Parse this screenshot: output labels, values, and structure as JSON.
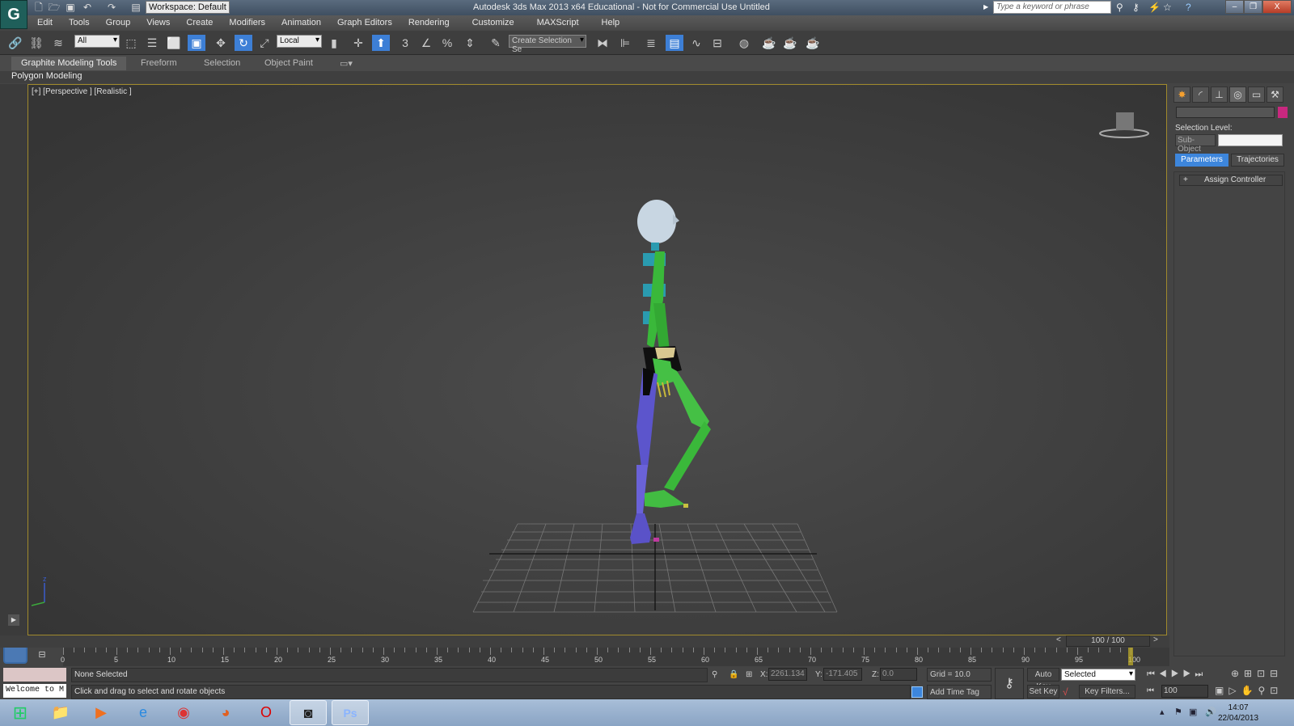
{
  "titlebar": {
    "workspace": "Workspace: Default",
    "title": "Autodesk 3ds Max  2013 x64   Educational - Not for Commercial Use    Untitled",
    "search_placeholder": "Type a keyword or phrase"
  },
  "menu": [
    "Edit",
    "Tools",
    "Group",
    "Views",
    "Create",
    "Modifiers",
    "Animation",
    "Graph Editors",
    "Rendering",
    "Customize",
    "MAXScript",
    "Help"
  ],
  "toolbar": {
    "selection_filter": "All",
    "ref_coord": "Local",
    "selection_set": "Create Selection Se",
    "snap_angle": "3",
    "snap_percent": "%"
  },
  "ribbon": {
    "tabs": [
      "Graphite Modeling Tools",
      "Freeform",
      "Selection",
      "Object Paint"
    ],
    "sub": "Polygon Modeling"
  },
  "viewport": {
    "label": "[+] [Perspective ] [Realistic ]",
    "axis_z": "z"
  },
  "command_panel": {
    "selection_level": "Selection Level:",
    "sub_object": "Sub-Object",
    "parameters": "Parameters",
    "trajectories": "Trajectories",
    "assign_controller": "Assign Controller",
    "color": "#c8287f"
  },
  "timeline": {
    "slider": "100 / 100",
    "ticks": [
      "0",
      "5",
      "10",
      "15",
      "20",
      "25",
      "30",
      "35",
      "40",
      "45",
      "50",
      "55",
      "60",
      "65",
      "70",
      "75",
      "80",
      "85",
      "90",
      "95",
      "100"
    ],
    "current_frame": 100,
    "total_frames": 100
  },
  "status": {
    "selection": "None Selected",
    "prompt": "Click and drag to select and rotate objects",
    "listener": "Welcome to M",
    "x_label": "X:",
    "x": "2261.134",
    "y_label": "Y:",
    "y": "-171.405",
    "z_label": "Z:",
    "z": "0.0",
    "grid": "Grid = 10.0",
    "add_time_tag": "Add Time Tag"
  },
  "anim": {
    "auto_key": "Auto Key",
    "set_key": "Set Key",
    "key_mode": "Selected",
    "key_filters": "Key Filters...",
    "frame": "100"
  },
  "taskbar": {
    "time": "14:07",
    "date": "22/04/2013"
  }
}
